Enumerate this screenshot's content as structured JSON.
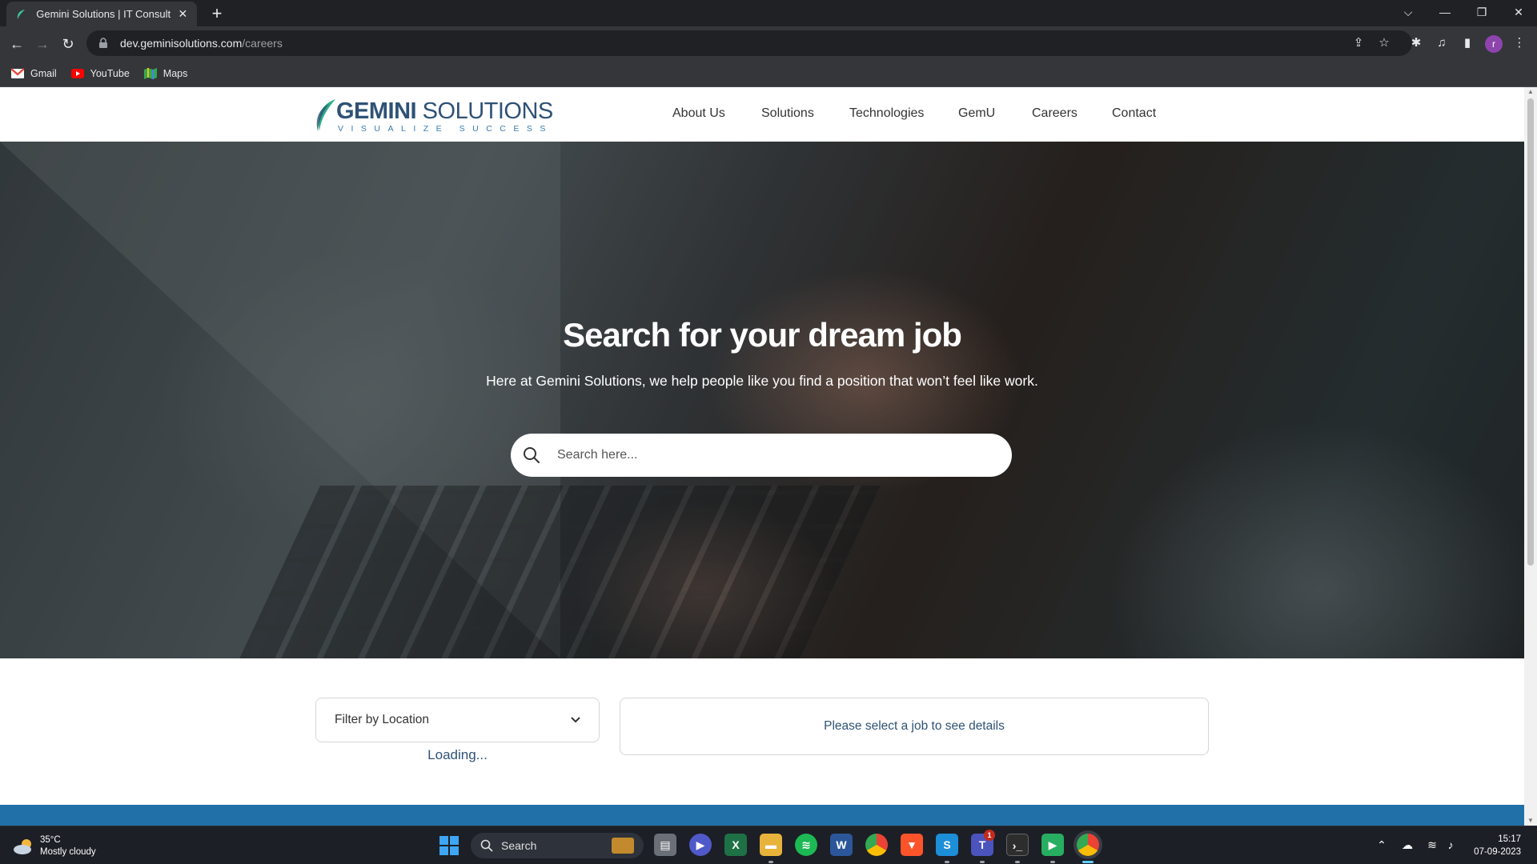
{
  "browser": {
    "tab_title": "Gemini Solutions | IT Consulting,",
    "url_host": "dev.geminisolutions.com",
    "url_path": "/careers",
    "profile_initial": "r",
    "bookmarks": [
      {
        "label": "Gmail",
        "icon": "gmail-icon"
      },
      {
        "label": "YouTube",
        "icon": "youtube-icon"
      },
      {
        "label": "Maps",
        "icon": "maps-icon"
      }
    ]
  },
  "site": {
    "logo_word1": "GEMINI",
    "logo_word2": " SOLUTIONS",
    "logo_tagline": "VISUALIZE SUCCESS",
    "nav": [
      "About Us",
      "Solutions",
      "Technologies",
      "GemU",
      "Careers",
      "Contact"
    ]
  },
  "hero": {
    "title": "Search for your dream job",
    "subtitle": "Here at Gemini Solutions, we help people like you find a position that won’t feel like work.",
    "search_placeholder": "Search here..."
  },
  "jobs": {
    "filter_label": "Filter by Location",
    "loading_text": "Loading...",
    "details_placeholder": "Please select a job to see details"
  },
  "taskbar": {
    "temperature": "35°C",
    "weather_desc": "Mostly cloudy",
    "search_label": "Search",
    "time": "15:17",
    "date": "07-09-2023",
    "teams_badge": "1",
    "apps": [
      "file-explorer-icon",
      "video-call-icon",
      "excel-icon",
      "folder-icon",
      "spotify-icon",
      "word-icon",
      "chrome-icon",
      "brave-icon",
      "sublime-text-icon",
      "teams-icon",
      "terminal-icon",
      "media-player-icon",
      "chrome-profile-icon"
    ]
  },
  "colors": {
    "brand_navy": "#2f5276",
    "brand_blue": "#2171a8",
    "tagline_blue": "#3a7ab1",
    "logo_green": "#2fae87"
  }
}
